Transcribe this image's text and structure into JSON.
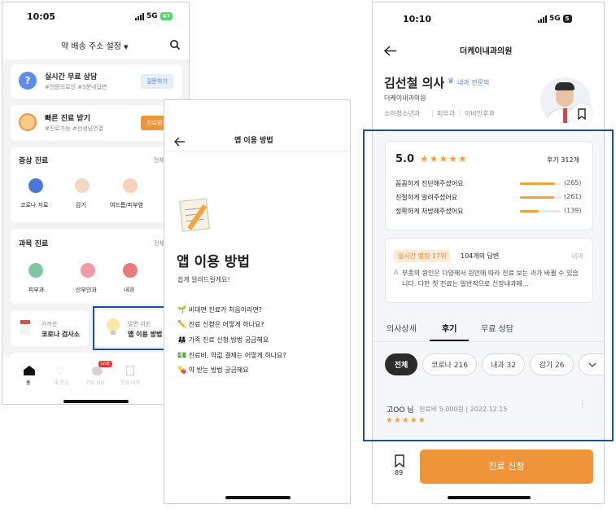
{
  "phone1": {
    "status": {
      "time": "10:05",
      "network": "5G",
      "battery": "47"
    },
    "header": {
      "title": "약 배송 주소 설정"
    },
    "consult": {
      "title": "실시간 무료 상담",
      "tags": "#전문의료인 #5분내답변",
      "button": "질문하기"
    },
    "quick": {
      "title": "빠른 진료 받기",
      "tags": "#진료가능 #선생님연결",
      "button": "진료받기"
    },
    "symptom": {
      "title": "증상 진료",
      "more": "전체보",
      "items": [
        "코로나 치료",
        "감기",
        "여드름/피부염",
        "시"
      ]
    },
    "dept": {
      "title": "과목 진료",
      "more": "전체보",
      "items": [
        "피부과",
        "산부인과",
        "내과",
        "소아"
      ]
    },
    "bottom_cards": {
      "nearby_small": "가까운",
      "nearby": "코로나 검사소",
      "guide_small": "알면 쉬운",
      "guide": "앱 이용 방법"
    },
    "tabbar": [
      "홈",
      "내 건강",
      "무료 상담",
      "진료 내역",
      "마이페이지"
    ],
    "live_badge": "LIVE"
  },
  "phone2": {
    "header": {
      "title": "앱 이용 방법"
    },
    "title": "앱 이용 방법",
    "subtitle": "쉽게 알려드릴게요!",
    "items": [
      {
        "icon": "🌱",
        "text": "비대면 진료가 처음이라면?"
      },
      {
        "icon": "✏️",
        "text": "진료 신청은 어떻게 하나요?"
      },
      {
        "icon": "👨‍👩‍👧",
        "text": "가족 진료 신청 방법 궁금해요"
      },
      {
        "icon": "💵",
        "text": "진료비, 약값 결제는 어떻게 하나요?"
      },
      {
        "icon": "💊",
        "text": "약 받는 방법 궁금해요"
      }
    ]
  },
  "phone3": {
    "status": {
      "time": "10:10",
      "network": "5G",
      "battery": "5"
    },
    "header": {
      "title": "더케이내과의원"
    },
    "doctor": {
      "name": "김선철 의사",
      "specialty": "내과 전문의",
      "clinic": "더케이내과의원",
      "tags": [
        "소아청소년과",
        "피부과",
        "이비인후과"
      ]
    },
    "rating": {
      "score": "5.0",
      "review_count": "후기 312개",
      "items": [
        {
          "label": "꼼꼼하게 진단해주셨어요",
          "count": "(265)",
          "fraction": 0.85
        },
        {
          "label": "친절하게 알려주셨어요",
          "count": "(261)",
          "fraction": 0.84
        },
        {
          "label": "정확하게 처방해주셨어요",
          "count": "(139)",
          "fraction": 0.45
        }
      ]
    },
    "ranking": {
      "badge": "실시간 랭킹 17위",
      "answers": "104개의 답변",
      "dept": "내과",
      "answer_text": "부종의 원인은 다양해서 원인에 따라 진료 보는 과가 바뀔 수 있습니다. 다만 첫 진료는 일반적으로 신장내과에..."
    },
    "tabs": [
      "의사상세",
      "후기",
      "무료 상담"
    ],
    "chips": [
      "전체",
      "코로나 216",
      "내과 32",
      "감기 26"
    ],
    "review": {
      "author": "고OO 님",
      "meta": "진료비 5,000원 | 2022.12.15",
      "stars": "★★★★★"
    },
    "bookmark_count": "89",
    "cta": "진료 신청"
  },
  "colors": {
    "accent_orange": "#f0943a",
    "highlight_blue": "#1f4e9c",
    "dark_chip": "#2b2b2b"
  }
}
